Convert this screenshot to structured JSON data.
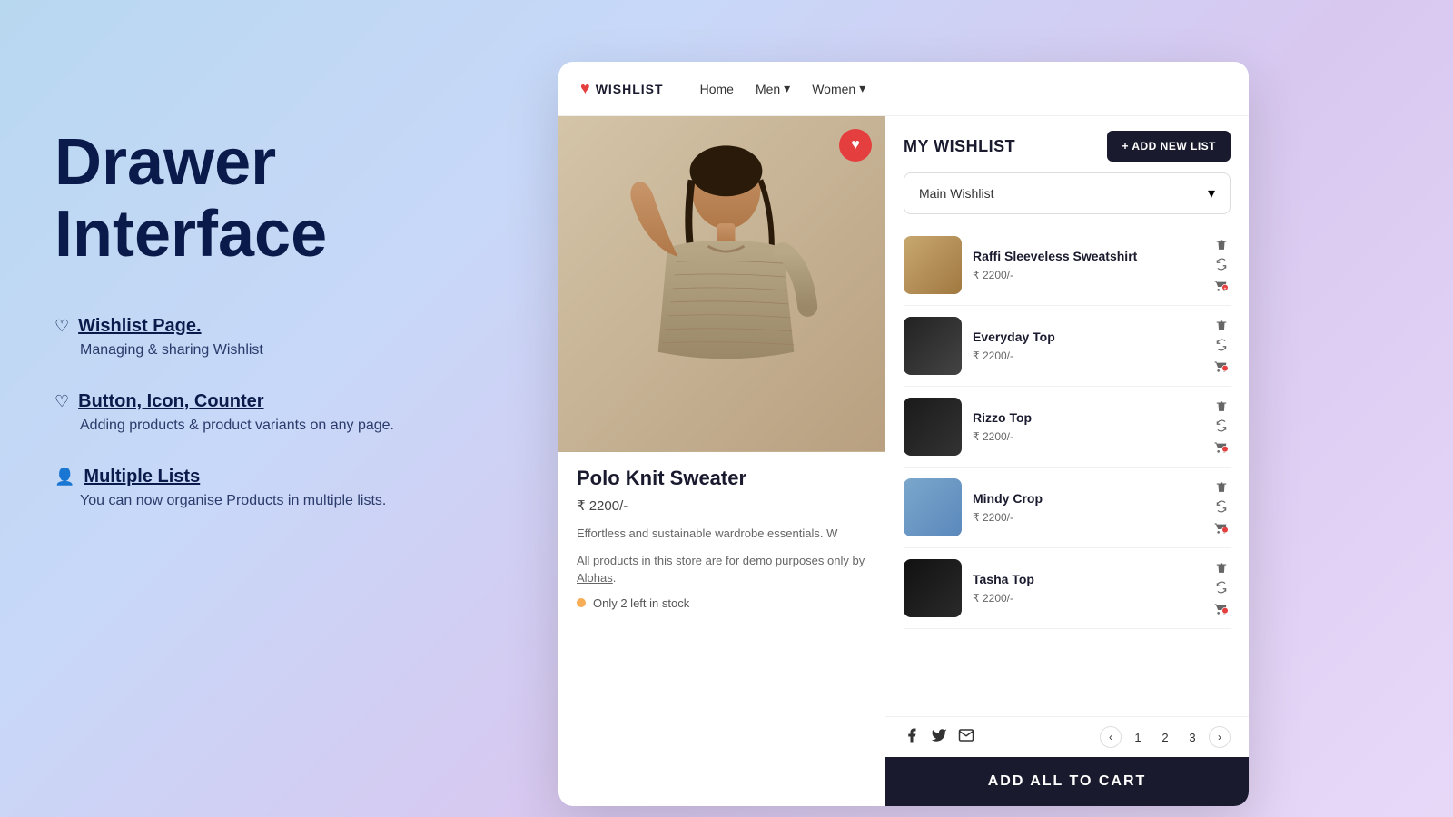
{
  "background": {
    "gradient": "linear-gradient(135deg, #b8d8f0, #c8d8f8, #d8c8f0, #e8d8f8)"
  },
  "left_panel": {
    "headline": "Drawer Interface",
    "features": [
      {
        "icon": "♡",
        "title": "Wishlist Page.",
        "description": "Managing & sharing Wishlist"
      },
      {
        "icon": "♡",
        "title": "Button, Icon, Counter",
        "description": "Adding products & product variants on any page."
      },
      {
        "icon": "👤",
        "title": "Multiple Lists",
        "description": "You can now organise Products in multiple lists."
      }
    ]
  },
  "nav": {
    "logo_text": "WISHLIST",
    "links": [
      {
        "label": "Home",
        "has_dropdown": false
      },
      {
        "label": "Men",
        "has_dropdown": true
      },
      {
        "label": "Women",
        "has_dropdown": true
      }
    ]
  },
  "product": {
    "name": "Polo Knit Sweater",
    "price": "₹ 2200/-",
    "description": "Effortless and sustainable wardrobe essentials. W",
    "footnote": "All products in this store are for demo purposes only by Alohas.",
    "stock_text": "Only 2 left in stock",
    "heart_active": true
  },
  "wishlist": {
    "title": "MY WISHLIST",
    "add_new_label": "+ ADD NEW LIST",
    "dropdown_label": "Main Wishlist",
    "items": [
      {
        "name": "Raffi Sleeveless Sweatshirt",
        "price": "₹ 2200/-",
        "thumb_class": "thumb-1"
      },
      {
        "name": "Everyday Top",
        "price": "₹ 2200/-",
        "thumb_class": "thumb-2"
      },
      {
        "name": "Rizzo Top",
        "price": "₹ 2200/-",
        "thumb_class": "thumb-3"
      },
      {
        "name": "Mindy Crop",
        "price": "₹ 2200/-",
        "thumb_class": "thumb-4"
      },
      {
        "name": "Tasha Top",
        "price": "₹ 2200/-",
        "thumb_class": "thumb-5"
      }
    ],
    "pagination": {
      "pages": [
        "1",
        "2",
        "3"
      ]
    },
    "add_all_label": "ADD ALL TO  CART"
  }
}
